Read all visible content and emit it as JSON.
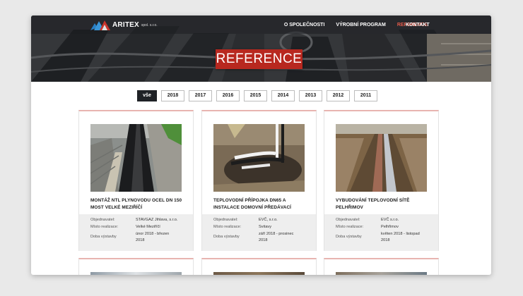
{
  "brand": {
    "name": "ARITEX",
    "suffix": "spol. s.r.o."
  },
  "nav": [
    {
      "label": "O SPOLEČNOSTI",
      "active": false
    },
    {
      "label": "VÝROBNÍ PROGRAM",
      "active": false
    },
    {
      "label": "REFERENCE",
      "active": true
    }
  ],
  "nav_last": {
    "label": "KONTAKT",
    "active": false
  },
  "hero": {
    "title": "REFERENCE"
  },
  "filters": [
    "vše",
    "2018",
    "2017",
    "2016",
    "2015",
    "2014",
    "2013",
    "2012",
    "2011"
  ],
  "active_filter": "vše",
  "colors": {
    "accent": "#b8281f",
    "nav_active": "#e05a4a",
    "dark": "#1f2226"
  },
  "meta_labels": {
    "client": "Objednavatel:",
    "location": "Místo realizace:",
    "duration": "Doba výstavby"
  },
  "cards": [
    {
      "title": "MONTÁŽ NTL PLYNOVODU OCEL DN 150 MOST VELKÉ MEZIŘÍČÍ",
      "client": "STAVGAZ Jihlava, s.r.o.",
      "location": "Velké Meziříčí",
      "duration_line1": "únor 2018 - březen",
      "duration_line2": "2018"
    },
    {
      "title": "TEPLOVODNÍ PŘÍPOJKA DN65 A INSTALACE DOMOVNÍ PŘEDÁVACÍ",
      "client": "EVČ, s.r.o.",
      "location": "Svitavy",
      "duration_line1": "září 2018 - prosinec",
      "duration_line2": "2018"
    },
    {
      "title": "VYBUDOVÁNÍ TEPLOVODNÍ SÍTĚ PELHŘIMOV",
      "client": "EVČ s.r.o.",
      "location": "Pelhřimov",
      "duration_line1": "květen 2018 - listopad",
      "duration_line2": "2018"
    }
  ]
}
